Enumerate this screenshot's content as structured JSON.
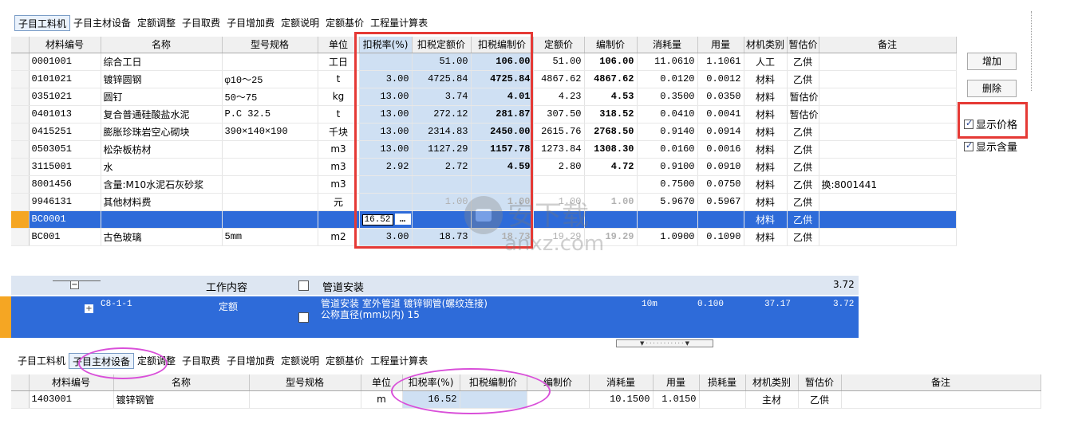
{
  "top": {
    "tabs": [
      "子目工料机",
      "子目主材设备",
      "定额调整",
      "子目取费",
      "子目增加费",
      "定额说明",
      "定额基价",
      "工程量计算表"
    ],
    "active_tab": 0,
    "columns": [
      "材料编号",
      "名称",
      "型号规格",
      "单位",
      "扣税率(%)",
      "扣税定额价",
      "扣税编制价",
      "定额价",
      "编制价",
      "消耗量",
      "用量",
      "材机类别",
      "暂估价",
      "备注"
    ],
    "rows": [
      {
        "code": "0001001",
        "name": "综合工日",
        "spec": "",
        "unit": "工日",
        "rate": "",
        "tax_quota": "51.00",
        "tax_comp": "106.00",
        "quota": "51.00",
        "comp": "106.00",
        "consume": "11.0610",
        "usage": "1.1061",
        "category": "人工",
        "temp": "乙供",
        "note": ""
      },
      {
        "code": "0101021",
        "name": "镀锌圆钢",
        "spec": "φ10～25",
        "unit": "t",
        "rate": "3.00",
        "tax_quota": "4725.84",
        "tax_comp": "4725.84",
        "quota": "4867.62",
        "comp": "4867.62",
        "consume": "0.0120",
        "usage": "0.0012",
        "category": "材料",
        "temp": "乙供",
        "note": ""
      },
      {
        "code": "0351021",
        "name": "圆钉",
        "spec": "50～75",
        "unit": "kg",
        "rate": "13.00",
        "tax_quota": "3.74",
        "tax_comp": "4.01",
        "quota": "4.23",
        "comp": "4.53",
        "consume": "0.3500",
        "usage": "0.0350",
        "category": "材料",
        "temp": "暂估价",
        "note": ""
      },
      {
        "code": "0401013",
        "name": "复合普通硅酸盐水泥",
        "spec": "P.C  32.5",
        "unit": "t",
        "rate": "13.00",
        "tax_quota": "272.12",
        "tax_comp": "281.87",
        "quota": "307.50",
        "comp": "318.52",
        "consume": "0.0410",
        "usage": "0.0041",
        "category": "材料",
        "temp": "暂估价",
        "note": ""
      },
      {
        "code": "0415251",
        "name": "膨胀珍珠岩空心砌块",
        "spec": "390×140×190",
        "unit": "千块",
        "rate": "13.00",
        "tax_quota": "2314.83",
        "tax_comp": "2450.00",
        "quota": "2615.76",
        "comp": "2768.50",
        "consume": "0.9140",
        "usage": "0.0914",
        "category": "材料",
        "temp": "乙供",
        "note": ""
      },
      {
        "code": "0503051",
        "name": "松杂板枋材",
        "spec": "",
        "unit": "m3",
        "rate": "13.00",
        "tax_quota": "1127.29",
        "tax_comp": "1157.78",
        "quota": "1273.84",
        "comp": "1308.30",
        "consume": "0.0160",
        "usage": "0.0016",
        "category": "材料",
        "temp": "乙供",
        "note": ""
      },
      {
        "code": "3115001",
        "name": "水",
        "spec": "",
        "unit": "m3",
        "rate": "2.92",
        "tax_quota": "2.72",
        "tax_comp": "4.59",
        "quota": "2.80",
        "comp": "4.72",
        "consume": "0.9100",
        "usage": "0.0910",
        "category": "材料",
        "temp": "乙供",
        "note": ""
      },
      {
        "code": "8001456",
        "name": "含量:M10水泥石灰砂浆",
        "spec": "",
        "unit": "m3",
        "rate": "",
        "tax_quota": "",
        "tax_comp": "",
        "quota": "",
        "comp": "",
        "consume": "0.7500",
        "usage": "0.0750",
        "category": "材料",
        "temp": "乙供",
        "note": "换:8001441"
      },
      {
        "code": "9946131",
        "name": "其他材料费",
        "spec": "",
        "unit": "元",
        "rate": "",
        "tax_quota": "1.00",
        "tax_comp": "1.00",
        "quota": "1.00",
        "comp": "1.00",
        "consume": "5.9670",
        "usage": "0.5967",
        "category": "材料",
        "temp": "乙供",
        "note": ""
      },
      {
        "code": "BC0001",
        "name": "",
        "spec": "",
        "unit": "",
        "rate": "16.52",
        "tax_quota": "",
        "tax_comp": "",
        "quota": "",
        "comp": "",
        "consume": "",
        "usage": "",
        "category": "材料",
        "temp": "乙供",
        "note": ""
      },
      {
        "code": "BC001",
        "name": "古色玻璃",
        "spec": "5mm",
        "unit": "m2",
        "rate": "3.00",
        "tax_quota": "18.73",
        "tax_comp": "18.73",
        "quota": "19.29",
        "comp": "19.29",
        "consume": "1.0900",
        "usage": "0.1090",
        "category": "材料",
        "temp": "乙供",
        "note": ""
      }
    ],
    "edit_dots": "…",
    "buttons": {
      "add": "增加",
      "delete": "删除"
    },
    "checks": {
      "show_price": "显示价格",
      "show_content": "显示含量"
    }
  },
  "watermark": {
    "text_cn": "安下载",
    "text_en": "anxz.com"
  },
  "bottom": {
    "tree": {
      "row1": {
        "label": "工作内容",
        "desc": "管道安装",
        "total": "3.72"
      },
      "row2": {
        "code": "C8-1-1",
        "type": "定额",
        "desc": "管道安装 室外管道 镀锌钢管(螺纹连接) 公称直径(mm以内) 15",
        "unit": "10m",
        "qty": "0.100",
        "price": "37.17",
        "total": "3.72"
      }
    },
    "tabs": [
      "子目工料机",
      "子目主材设备",
      "定额调整",
      "子目取费",
      "子目增加费",
      "定额说明",
      "定额基价",
      "工程量计算表"
    ],
    "active_tab": 1,
    "columns": [
      "材料编号",
      "名称",
      "型号规格",
      "单位",
      "扣税率(%)",
      "扣税编制价",
      "编制价",
      "消耗量",
      "用量",
      "损耗量",
      "材机类别",
      "暂估价",
      "备注"
    ],
    "rows": [
      {
        "code": "1403001",
        "name": "镀锌钢管",
        "spec": "",
        "unit": "m",
        "rate": "16.52",
        "tax_comp": "",
        "comp": "",
        "consume": "10.1500",
        "usage": "1.0150",
        "loss": "",
        "category": "主材",
        "temp": "乙供",
        "note": ""
      }
    ]
  },
  "colors": {
    "selection": "#2e6bd9",
    "red": "#e53935",
    "magenta": "#d94fd9",
    "blue_col": "#cfe0f3"
  }
}
